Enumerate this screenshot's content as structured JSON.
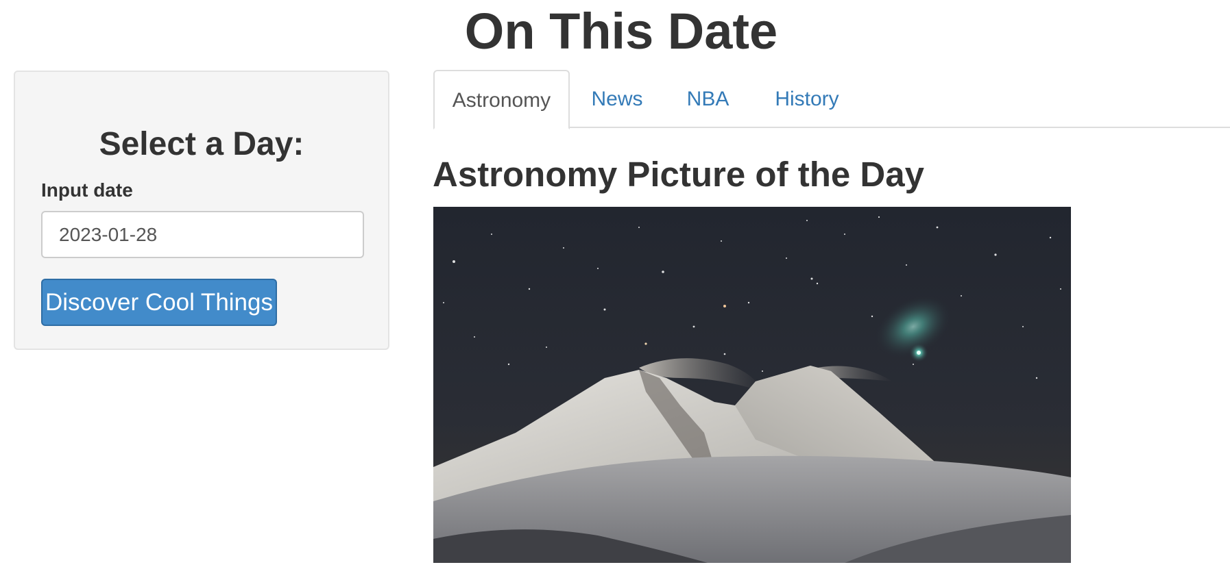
{
  "page": {
    "title": "On This Date"
  },
  "sidebar": {
    "heading": "Select a Day:",
    "date_input": {
      "label": "Input date",
      "value": "2023-01-28"
    },
    "discover_button_label": "Discover Cool Things"
  },
  "tabs": [
    {
      "label": "Astronomy",
      "active": true
    },
    {
      "label": "News",
      "active": false
    },
    {
      "label": "NBA",
      "active": false
    },
    {
      "label": "History",
      "active": false
    }
  ],
  "main": {
    "section_title": "Astronomy Picture of the Day"
  },
  "colors": {
    "primary_button": "#428bca",
    "link": "#337ab7",
    "sky": "#262a33",
    "comet": "#7fe6d2"
  }
}
